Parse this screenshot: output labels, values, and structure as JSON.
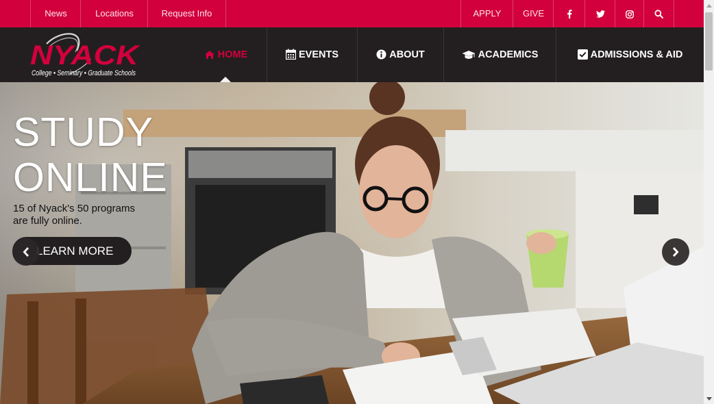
{
  "utility_nav": {
    "news": "News",
    "locations": "Locations",
    "request_info": "Request Info",
    "apply": "APPLY",
    "give": "GIVE",
    "social_icons": [
      "facebook-icon",
      "twitter-icon",
      "instagram-icon",
      "search-icon"
    ]
  },
  "logo": {
    "wordmark": "NYACK",
    "tagline": "College • Seminary • Graduate Schools"
  },
  "main_nav": {
    "home": "HOME",
    "events": "EVENTS",
    "about": "ABOUT",
    "academics": "ACADEMICS",
    "admissions": "ADMISSIONS & AID",
    "icons": [
      "home-icon",
      "calendar-icon",
      "info-icon",
      "graduation-cap-icon",
      "checkbox-icon"
    ]
  },
  "hero": {
    "title_line1": "STUDY",
    "title_line2": "ONLINE",
    "subtitle_line1": "15 of Nyack's 50 programs",
    "subtitle_line2": "are fully online.",
    "cta": "LEARN MORE"
  },
  "colors": {
    "brand_red": "#d2003c",
    "nav_dark": "#231f20",
    "white": "#ffffff"
  }
}
